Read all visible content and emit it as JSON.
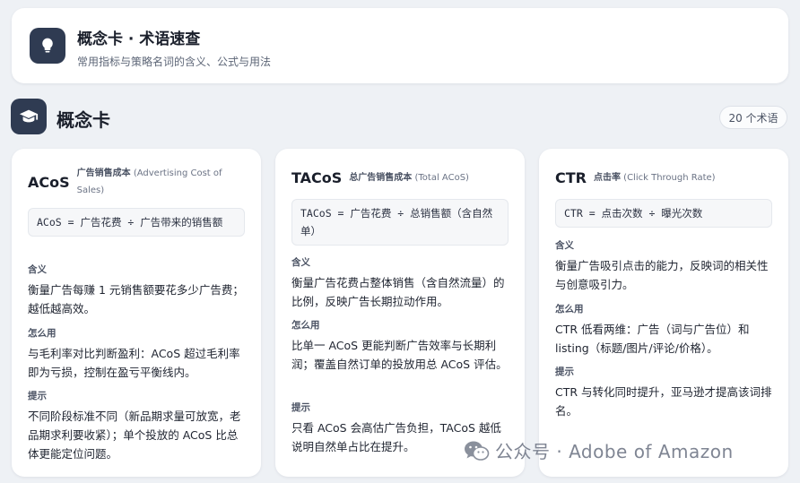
{
  "header": {
    "title": "概念卡 · 术语速查",
    "subtitle": "常用指标与策略名词的含义、公式与用法",
    "icon": "lightbulb-icon"
  },
  "section": {
    "title": "概念卡",
    "icon": "graduation-cap-icon",
    "count_badge": "20 个术语"
  },
  "cards": [
    {
      "term": "ACoS",
      "name_cn": "广告销售成本",
      "name_en": "(Advertising Cost of Sales)",
      "formula": "ACoS = 广告花费 ÷ 广告带来的销售额",
      "meaning_label": "含义",
      "meaning": "衡量广告每赚 1 元销售额要花多少广告费；越低越高效。",
      "usage_label": "怎么用",
      "usage": "与毛利率对比判断盈利：ACoS 超过毛利率即为亏损，控制在盈亏平衡线内。",
      "tip_label": "提示",
      "tip": "不同阶段标准不同（新品期求量可放宽，老品期求利要收紧）；单个投放的 ACoS 比总体更能定位问题。"
    },
    {
      "term": "TACoS",
      "name_cn": "总广告销售成本",
      "name_en": "(Total ACoS)",
      "formula": "TACoS = 广告花费 ÷ 总销售额（含自然单）",
      "meaning_label": "含义",
      "meaning": "衡量广告花费占整体销售（含自然流量）的比例，反映广告长期拉动作用。",
      "usage_label": "怎么用",
      "usage": "比单一 ACoS 更能判断广告效率与长期利润；覆盖自然订单的投放用总 ACoS 评估。",
      "tip_label": "提示",
      "tip": "只看 ACoS 会高估广告负担，TACoS 越低说明自然单占比在提升。"
    },
    {
      "term": "CTR",
      "name_cn": "点击率",
      "name_en": "(Click Through Rate)",
      "formula": "CTR = 点击次数 ÷ 曝光次数",
      "meaning_label": "含义",
      "meaning": "衡量广告吸引点击的能力，反映词的相关性与创意吸引力。",
      "usage_label": "怎么用",
      "usage": "CTR 低看两维：广告（词与广告位）和 listing（标题/图片/评论/价格）。",
      "tip_label": "提示",
      "tip": "CTR 与转化同时提升，亚马逊才提高该词排名。"
    }
  ],
  "watermark": {
    "icon": "wechat-icon",
    "text": "公众号 · Adobe of Amazon"
  }
}
